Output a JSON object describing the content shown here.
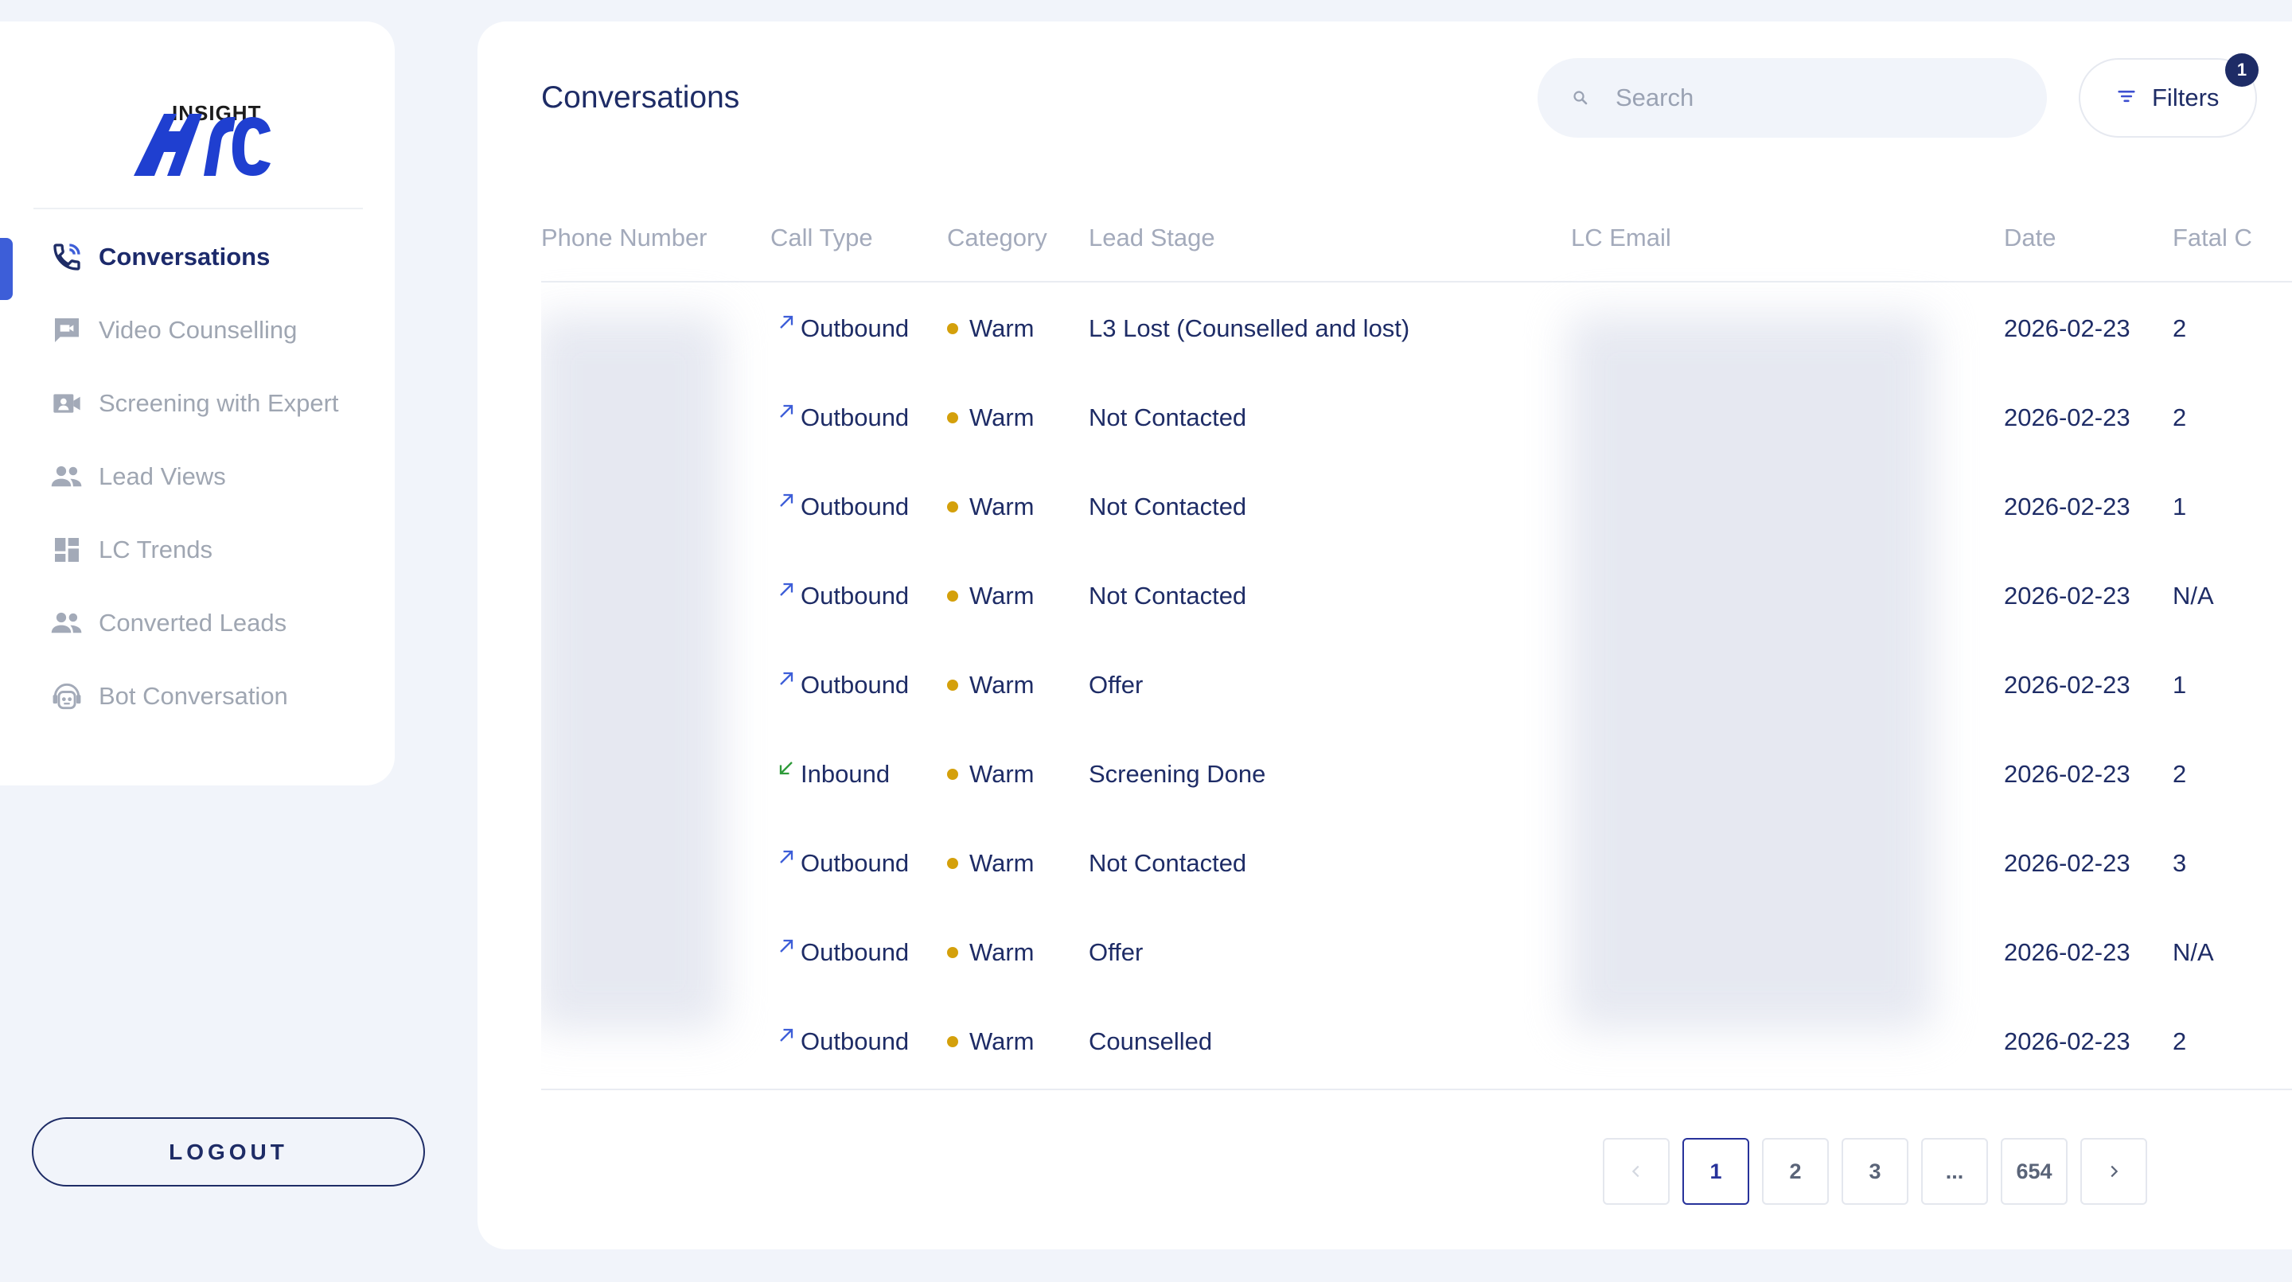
{
  "app": {
    "logo_top": "INSIGHT",
    "logo_bottom": "ARC",
    "brand_color": "#1f3fd0"
  },
  "sidebar": {
    "items": [
      {
        "label": "Conversations",
        "icon": "phone-call-icon",
        "active": true
      },
      {
        "label": "Video Counselling",
        "icon": "chat-bubble-icon",
        "active": false
      },
      {
        "label": "Screening with Expert",
        "icon": "video-user-icon",
        "active": false
      },
      {
        "label": "Lead Views",
        "icon": "people-icon",
        "active": false
      },
      {
        "label": "LC Trends",
        "icon": "dashboard-icon",
        "active": false
      },
      {
        "label": "Converted Leads",
        "icon": "people-icon",
        "active": false
      },
      {
        "label": "Bot Conversation",
        "icon": "bot-icon",
        "active": false
      }
    ],
    "logout_label": "LOGOUT"
  },
  "header": {
    "title": "Conversations",
    "search_placeholder": "Search",
    "filters_label": "Filters",
    "filters_count": "1"
  },
  "table": {
    "columns": [
      "Phone Number",
      "Call Type",
      "Category",
      "Lead Stage",
      "LC Email",
      "Date",
      "Fatal C"
    ],
    "rows": [
      {
        "call_type": "Outbound",
        "direction": "out",
        "category": "Warm",
        "lead_stage": "L3 Lost (Counselled and lost)",
        "date": "2026-02-23",
        "fatal": "2"
      },
      {
        "call_type": "Outbound",
        "direction": "out",
        "category": "Warm",
        "lead_stage": "Not Contacted",
        "date": "2026-02-23",
        "fatal": "2"
      },
      {
        "call_type": "Outbound",
        "direction": "out",
        "category": "Warm",
        "lead_stage": "Not Contacted",
        "date": "2026-02-23",
        "fatal": "1"
      },
      {
        "call_type": "Outbound",
        "direction": "out",
        "category": "Warm",
        "lead_stage": "Not Contacted",
        "date": "2026-02-23",
        "fatal": "N/A"
      },
      {
        "call_type": "Outbound",
        "direction": "out",
        "category": "Warm",
        "lead_stage": "Offer",
        "date": "2026-02-23",
        "fatal": "1"
      },
      {
        "call_type": "Inbound",
        "direction": "in",
        "category": "Warm",
        "lead_stage": "Screening Done",
        "date": "2026-02-23",
        "fatal": "2"
      },
      {
        "call_type": "Outbound",
        "direction": "out",
        "category": "Warm",
        "lead_stage": "Not Contacted",
        "date": "2026-02-23",
        "fatal": "3"
      },
      {
        "call_type": "Outbound",
        "direction": "out",
        "category": "Warm",
        "lead_stage": "Offer",
        "date": "2026-02-23",
        "fatal": "N/A"
      },
      {
        "call_type": "Outbound",
        "direction": "out",
        "category": "Warm",
        "lead_stage": "Counselled",
        "date": "2026-02-23",
        "fatal": "2"
      }
    ],
    "highlighted_row": 3
  },
  "pagination": {
    "pages": [
      "1",
      "2",
      "3",
      "...",
      "654"
    ],
    "current": "1"
  },
  "colors": {
    "text_dark": "#1e2c66",
    "warm_dot": "#d4a00b",
    "outbound_arrow": "#3d5ed8",
    "inbound_arrow": "#2e9b3a"
  }
}
